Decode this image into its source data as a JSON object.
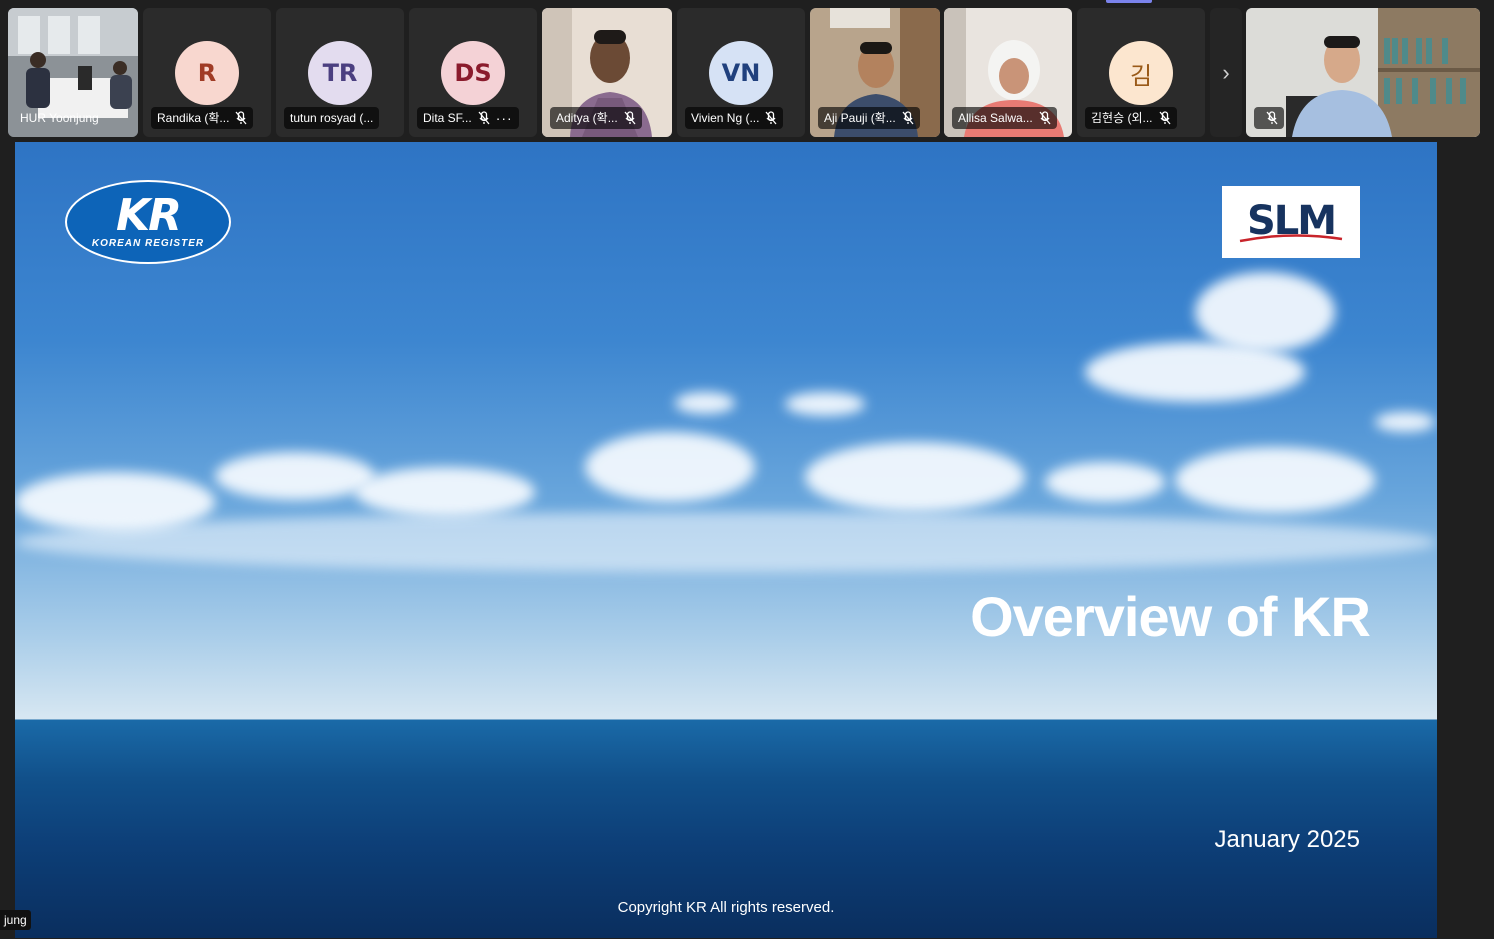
{
  "participants": [
    {
      "name": "HUR Yoonjung",
      "type": "video"
    },
    {
      "name": "Randika (확...",
      "type": "avatar",
      "initials": "R",
      "bg": "#f8d7cf",
      "fg": "#a03b25"
    },
    {
      "name": "tutun rosyad (...",
      "type": "avatar",
      "initials": "TR",
      "bg": "#e3dcef",
      "fg": "#4b3f80"
    },
    {
      "name": "Dita SF...",
      "type": "avatar",
      "initials": "DS",
      "bg": "#f4d2d6",
      "fg": "#8a1b2c"
    },
    {
      "name": "Aditya (확...",
      "type": "video"
    },
    {
      "name": "Vivien Ng (...",
      "type": "avatar",
      "initials": "VN",
      "bg": "#d6e2f5",
      "fg": "#20407d"
    },
    {
      "name": "Aji Pauji (확...",
      "type": "video"
    },
    {
      "name": "Allisa Salwa...",
      "type": "video"
    },
    {
      "name": "김현승 (외...",
      "type": "avatar",
      "initials": "김",
      "bg": "#fce6cf",
      "fg": "#9a5a18"
    },
    {
      "name": "",
      "type": "video"
    }
  ],
  "strip": {
    "more_glyph": "···",
    "next_glyph": "›"
  },
  "slide": {
    "logo_left_mark": "KR",
    "logo_left_text": "KOREAN REGISTER",
    "logo_right_text": "SLM",
    "title": "Overview of KR",
    "date": "January 2025",
    "copyright": "Copyright KR All rights reserved."
  },
  "pinned_label": "jung",
  "colors": {
    "accent": "#7b83eb",
    "kr_blue": "#0d64b8",
    "slm_navy": "#17335f",
    "slm_red": "#c8242b"
  }
}
